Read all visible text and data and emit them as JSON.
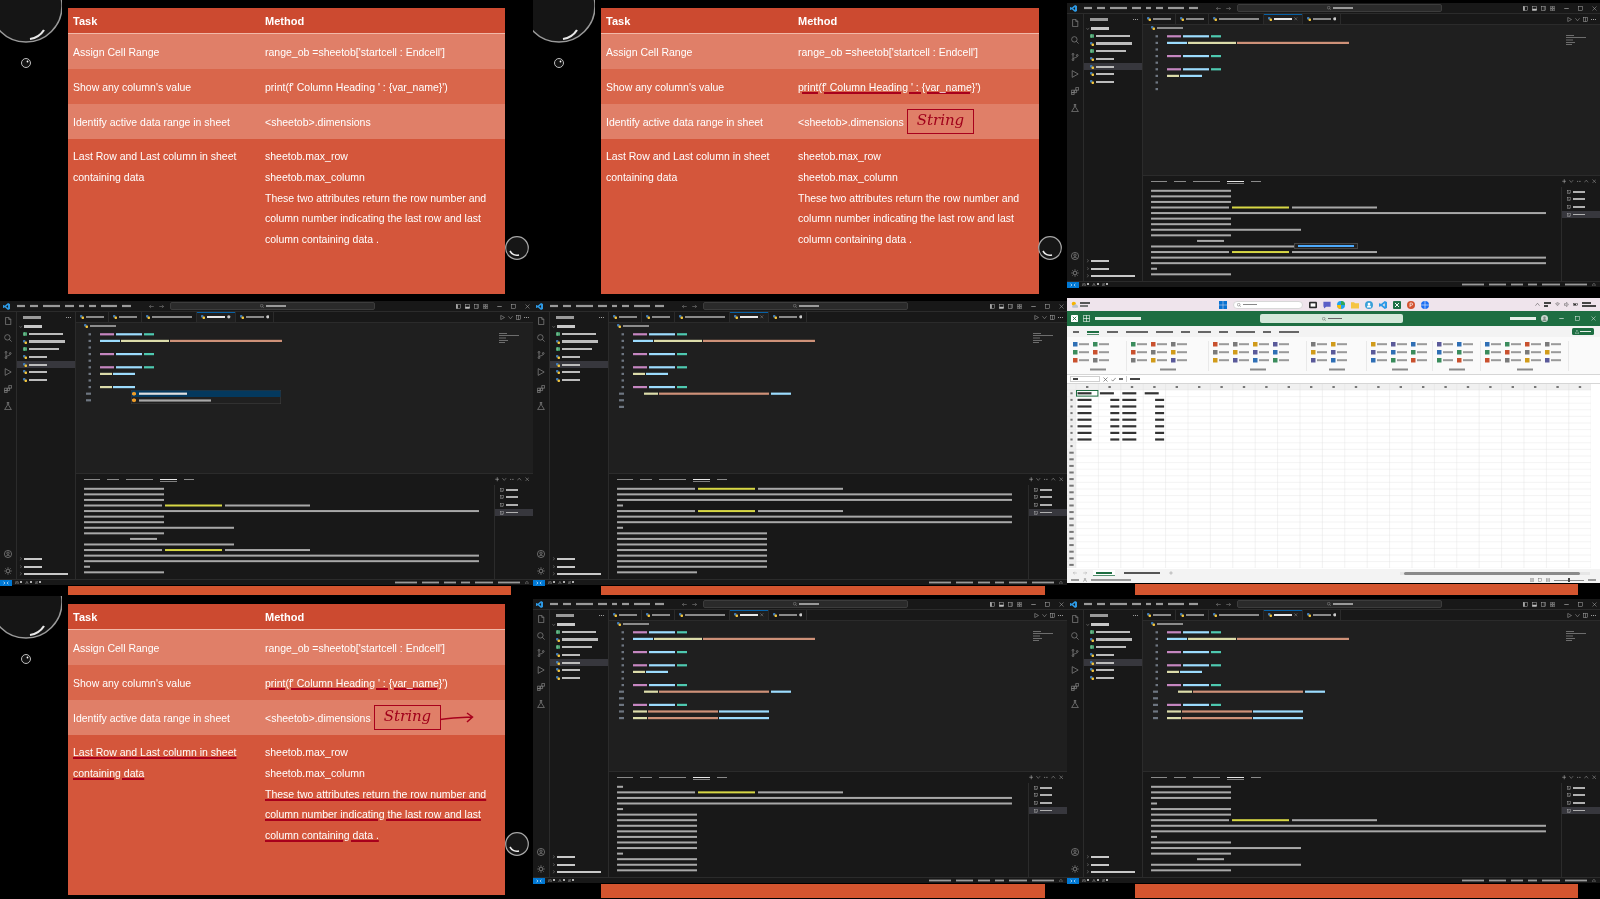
{
  "frames": [
    {
      "kind": "slide",
      "header": {
        "task": "Task",
        "method": "Method"
      },
      "rows": [
        {
          "task": "Assign Cell Range",
          "method": [
            "range_ob =sheetob['startcell : Endcell']"
          ],
          "task_underlined": false,
          "method_underlined": false
        },
        {
          "task": "Show any column's value",
          "method": [
            "print(f' Column Heading ' : {var_name}')"
          ],
          "task_underlined": false,
          "method_underlined": false
        },
        {
          "task": "Identify active data range in sheet",
          "method": [
            "<sheetob>.dimensions"
          ],
          "task_underlined": false,
          "method_underlined": false
        },
        {
          "task": "Last Row and Last column in sheet containing data",
          "method": [
            "sheetob.max_row",
            "sheetob.max_column"
          ],
          "description": "These two attributes return the row number and column number indicating the last row and last column containing data .",
          "task_underlined": false,
          "method_underlined": false,
          "description_underlined": false
        }
      ]
    },
    {
      "kind": "slide",
      "header": {
        "task": "Task",
        "method": "Method"
      },
      "rows": [
        {
          "task": "Assign Cell Range",
          "method": [
            "range_ob =sheetob['startcell : Endcell']"
          ],
          "task_underlined": false,
          "method_underlined": false
        },
        {
          "task": "Show any column's value",
          "method": [
            "print(f' Column Heading ' : {var_name}')"
          ],
          "task_underlined": false,
          "method_underlined": true
        },
        {
          "task": "Identify active data range in sheet",
          "method": [
            "<sheetob>.dimensions"
          ],
          "task_underlined": false,
          "method_underlined": false,
          "note": "String",
          "note_arrow": false
        },
        {
          "task": "Last Row and Last column in sheet containing data",
          "method": [
            "sheetob.max_row",
            "sheetob.max_column"
          ],
          "description": "These two attributes return the row number and column number indicating the last row and last column containing data .",
          "task_underlined": false,
          "method_underlined": false,
          "description_underlined": false
        }
      ]
    },
    {
      "kind": "vscode",
      "files": [
        {
          "kind": "sheet",
          "selected": false
        },
        {
          "kind": "python",
          "selected": false
        },
        {
          "kind": "sheet",
          "selected": false
        },
        {
          "kind": "python",
          "selected": false
        },
        {
          "kind": "python",
          "selected": true
        },
        {
          "kind": "python",
          "selected": false
        },
        {
          "kind": "python",
          "selected": false
        }
      ],
      "tabs": [
        {
          "selected": false,
          "modified": false
        },
        {
          "selected": false,
          "modified": false
        },
        {
          "selected": false,
          "modified": false
        },
        {
          "selected": true,
          "modified": false
        },
        {
          "selected": false,
          "modified": true
        }
      ],
      "code": [
        {
          "kind": "medium"
        },
        {
          "kind": "long"
        },
        {
          "kind": "blank"
        },
        {
          "kind": "medium"
        },
        {
          "kind": "blank"
        },
        {
          "kind": "medium"
        },
        {
          "kind": "short"
        },
        {
          "kind": "blank"
        },
        {
          "kind": "blank"
        }
      ],
      "panel_tabs": [
        {
          "selected": false
        },
        {
          "selected": false
        },
        {
          "selected": false
        },
        {
          "selected": true
        },
        {
          "selected": false
        }
      ],
      "terminal": [
        {
          "kind": "short"
        },
        {
          "kind": "short"
        },
        {
          "kind": "short"
        },
        {
          "kind": "long"
        },
        {
          "kind": "full"
        },
        {
          "kind": "short"
        },
        {
          "kind": "short"
        },
        {
          "kind": "medium"
        },
        {
          "kind": "short"
        },
        {
          "kind": "caret"
        },
        {
          "kind": "medium"
        },
        {
          "kind": "long"
        },
        {
          "kind": "full"
        },
        {
          "kind": "full"
        },
        {
          "kind": "tiny"
        },
        {
          "kind": "short"
        }
      ],
      "link_tooltip": true,
      "terminals": [
        {
          "selected": false
        },
        {
          "selected": false
        },
        {
          "selected": false
        },
        {
          "selected": true
        }
      ]
    },
    {
      "kind": "vscode",
      "slide_edge": true,
      "files": [
        {
          "kind": "sheet",
          "selected": false
        },
        {
          "kind": "python",
          "selected": false
        },
        {
          "kind": "sheet",
          "selected": false
        },
        {
          "kind": "python",
          "selected": false
        },
        {
          "kind": "python",
          "selected": true
        },
        {
          "kind": "python",
          "selected": false
        },
        {
          "kind": "python",
          "selected": false
        }
      ],
      "tabs": [
        {
          "selected": false,
          "modified": false
        },
        {
          "selected": false,
          "modified": false
        },
        {
          "selected": false,
          "modified": false
        },
        {
          "selected": true,
          "modified": true
        },
        {
          "selected": false,
          "modified": true
        }
      ],
      "code": [
        {
          "kind": "medium"
        },
        {
          "kind": "long"
        },
        {
          "kind": "blank"
        },
        {
          "kind": "medium"
        },
        {
          "kind": "blank"
        },
        {
          "kind": "medium"
        },
        {
          "kind": "short"
        },
        {
          "kind": "blank"
        },
        {
          "kind": "short"
        },
        {
          "kind": "blank"
        },
        {
          "kind": "blank"
        }
      ],
      "autocomplete": true,
      "panel_tabs": [
        {
          "selected": false
        },
        {
          "selected": false
        },
        {
          "selected": false
        },
        {
          "selected": true
        },
        {
          "selected": false
        }
      ],
      "terminal": [
        {
          "kind": "short"
        },
        {
          "kind": "short"
        },
        {
          "kind": "short"
        },
        {
          "kind": "long"
        },
        {
          "kind": "full"
        },
        {
          "kind": "short"
        },
        {
          "kind": "short"
        },
        {
          "kind": "medium"
        },
        {
          "kind": "short"
        },
        {
          "kind": "caret"
        },
        {
          "kind": "medium"
        },
        {
          "kind": "long"
        },
        {
          "kind": "full"
        },
        {
          "kind": "full"
        },
        {
          "kind": "tiny"
        },
        {
          "kind": "short"
        }
      ],
      "terminals": [
        {
          "selected": false
        },
        {
          "selected": false
        },
        {
          "selected": false
        },
        {
          "selected": true
        }
      ]
    },
    {
      "kind": "vscode",
      "slide_edge": true,
      "files": [
        {
          "kind": "sheet",
          "selected": false
        },
        {
          "kind": "python",
          "selected": false
        },
        {
          "kind": "sheet",
          "selected": false
        },
        {
          "kind": "python",
          "selected": false
        },
        {
          "kind": "python",
          "selected": true
        },
        {
          "kind": "python",
          "selected": false
        },
        {
          "kind": "python",
          "selected": false
        }
      ],
      "tabs": [
        {
          "selected": false,
          "modified": false
        },
        {
          "selected": false,
          "modified": false
        },
        {
          "selected": false,
          "modified": false
        },
        {
          "selected": true,
          "modified": false
        },
        {
          "selected": false,
          "modified": true
        }
      ],
      "code": [
        {
          "kind": "medium"
        },
        {
          "kind": "long"
        },
        {
          "kind": "blank"
        },
        {
          "kind": "medium"
        },
        {
          "kind": "blank"
        },
        {
          "kind": "medium"
        },
        {
          "kind": "short"
        },
        {
          "kind": "blank"
        },
        {
          "kind": "medium"
        },
        {
          "kind": "nested"
        },
        {
          "kind": "blank"
        },
        {
          "kind": "blank"
        }
      ],
      "panel_tabs": [
        {
          "selected": false
        },
        {
          "selected": false
        },
        {
          "selected": false
        },
        {
          "selected": true
        },
        {
          "selected": false
        }
      ],
      "terminal": [
        {
          "kind": "long"
        },
        {
          "kind": "full"
        },
        {
          "kind": "full"
        },
        {
          "kind": "tiny"
        },
        {
          "kind": "long"
        },
        {
          "kind": "full"
        },
        {
          "kind": "full"
        },
        {
          "kind": "tiny"
        },
        {
          "kind": "medium"
        },
        {
          "kind": "medium"
        },
        {
          "kind": "medium"
        },
        {
          "kind": "medium"
        },
        {
          "kind": "medium"
        },
        {
          "kind": "medium"
        },
        {
          "kind": "medium"
        },
        {
          "kind": "short"
        }
      ],
      "terminals": [
        {
          "selected": false
        },
        {
          "selected": false
        },
        {
          "selected": false
        },
        {
          "selected": true
        }
      ]
    },
    {
      "kind": "excel",
      "slide_edge": true,
      "ribbon_tabs": [
        {
          "selected": false
        },
        {
          "selected": true
        },
        {
          "selected": false
        },
        {
          "selected": false
        },
        {
          "selected": false
        },
        {
          "selected": false
        },
        {
          "selected": false
        },
        {
          "selected": false
        },
        {
          "selected": false
        },
        {
          "selected": false
        },
        {
          "selected": false
        }
      ],
      "rows": [
        {
          "kind": "header"
        },
        {
          "kind": "record"
        },
        {
          "kind": "record"
        },
        {
          "kind": "record"
        },
        {
          "kind": "record"
        },
        {
          "kind": "record"
        },
        {
          "kind": "record"
        },
        {
          "kind": "record"
        }
      ],
      "sheets": [
        {
          "selected": true
        },
        {
          "selected": false
        }
      ],
      "zoom": {
        "level": 0.5
      }
    },
    {
      "kind": "slide",
      "header": {
        "task": "Task",
        "method": "Method"
      },
      "rows": [
        {
          "task": "Assign Cell Range",
          "method": [
            "range_ob =sheetob['startcell : Endcell']"
          ],
          "task_underlined": false,
          "method_underlined": false
        },
        {
          "task": "Show any column's value",
          "method": [
            "print(f' Column Heading ' : {var_name}')"
          ],
          "task_underlined": false,
          "method_underlined": true
        },
        {
          "task": "Identify active data range in sheet",
          "method": [
            "<sheetob>.dimensions"
          ],
          "task_underlined": false,
          "method_underlined": false,
          "note": "String",
          "note_arrow": true
        },
        {
          "task": "Last Row and Last column in sheet containing data",
          "method": [
            "sheetob.max_row",
            "sheetob.max_column"
          ],
          "description": "These two attributes return the row number and column number indicating the last row and last column containing data .",
          "task_underlined": true,
          "method_underlined": false,
          "description_underlined": true
        }
      ]
    },
    {
      "kind": "vscode",
      "slide_edge": true,
      "files": [
        {
          "kind": "sheet",
          "selected": false
        },
        {
          "kind": "python",
          "selected": false
        },
        {
          "kind": "sheet",
          "selected": false
        },
        {
          "kind": "python",
          "selected": false
        },
        {
          "kind": "python",
          "selected": true
        },
        {
          "kind": "python",
          "selected": false
        },
        {
          "kind": "python",
          "selected": false
        }
      ],
      "tabs": [
        {
          "selected": false,
          "modified": false
        },
        {
          "selected": false,
          "modified": false
        },
        {
          "selected": false,
          "modified": false
        },
        {
          "selected": true,
          "modified": false
        },
        {
          "selected": false,
          "modified": true
        }
      ],
      "code": [
        {
          "kind": "medium"
        },
        {
          "kind": "long"
        },
        {
          "kind": "blank"
        },
        {
          "kind": "medium"
        },
        {
          "kind": "blank"
        },
        {
          "kind": "medium"
        },
        {
          "kind": "short"
        },
        {
          "kind": "blank"
        },
        {
          "kind": "medium"
        },
        {
          "kind": "nested"
        },
        {
          "kind": "blank"
        },
        {
          "kind": "medium"
        },
        {
          "kind": "wide"
        },
        {
          "kind": "wide"
        }
      ],
      "panel_tabs": [
        {
          "selected": false
        },
        {
          "selected": false
        },
        {
          "selected": false
        },
        {
          "selected": true
        },
        {
          "selected": false
        }
      ],
      "terminal": [
        {
          "kind": "tiny"
        },
        {
          "kind": "long"
        },
        {
          "kind": "full"
        },
        {
          "kind": "full"
        },
        {
          "kind": "tiny"
        },
        {
          "kind": "short"
        },
        {
          "kind": "short"
        },
        {
          "kind": "short"
        },
        {
          "kind": "short"
        },
        {
          "kind": "short"
        },
        {
          "kind": "short"
        },
        {
          "kind": "short"
        },
        {
          "kind": "tiny"
        },
        {
          "kind": "short"
        },
        {
          "kind": "short"
        },
        {
          "kind": "short"
        }
      ],
      "terminals": [
        {
          "selected": false
        },
        {
          "selected": false
        },
        {
          "selected": false
        },
        {
          "selected": true
        }
      ]
    },
    {
      "kind": "vscode",
      "slide_edge": true,
      "files": [
        {
          "kind": "sheet",
          "selected": false
        },
        {
          "kind": "python",
          "selected": false
        },
        {
          "kind": "sheet",
          "selected": false
        },
        {
          "kind": "python",
          "selected": false
        },
        {
          "kind": "python",
          "selected": true
        },
        {
          "kind": "python",
          "selected": false
        },
        {
          "kind": "python",
          "selected": false
        }
      ],
      "tabs": [
        {
          "selected": false,
          "modified": false
        },
        {
          "selected": false,
          "modified": false
        },
        {
          "selected": false,
          "modified": false
        },
        {
          "selected": true,
          "modified": false
        },
        {
          "selected": false,
          "modified": true
        }
      ],
      "code": [
        {
          "kind": "medium"
        },
        {
          "kind": "long"
        },
        {
          "kind": "blank"
        },
        {
          "kind": "medium"
        },
        {
          "kind": "blank"
        },
        {
          "kind": "medium"
        },
        {
          "kind": "short"
        },
        {
          "kind": "blank"
        },
        {
          "kind": "medium"
        },
        {
          "kind": "nested"
        },
        {
          "kind": "blank"
        },
        {
          "kind": "medium"
        },
        {
          "kind": "wide"
        },
        {
          "kind": "wide"
        }
      ],
      "panel_tabs": [
        {
          "selected": false
        },
        {
          "selected": false
        },
        {
          "selected": false
        },
        {
          "selected": true
        },
        {
          "selected": false
        }
      ],
      "terminal": [
        {
          "kind": "short"
        },
        {
          "kind": "short"
        },
        {
          "kind": "short"
        },
        {
          "kind": "tiny"
        },
        {
          "kind": "short"
        },
        {
          "kind": "short"
        },
        {
          "kind": "long"
        },
        {
          "kind": "full"
        },
        {
          "kind": "full"
        },
        {
          "kind": "tiny"
        },
        {
          "kind": "short"
        },
        {
          "kind": "medium"
        },
        {
          "kind": "short"
        },
        {
          "kind": "caret"
        },
        {
          "kind": "medium"
        },
        {
          "kind": "short"
        }
      ],
      "terminals": [
        {
          "selected": false
        },
        {
          "selected": false
        },
        {
          "selected": false
        },
        {
          "selected": true
        }
      ]
    }
  ]
}
